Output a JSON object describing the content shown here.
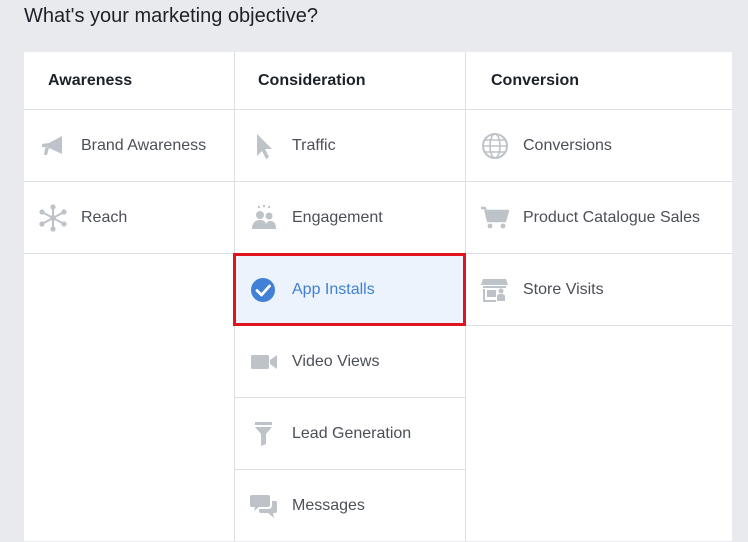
{
  "page_title": "What's your marketing objective?",
  "columns": [
    {
      "header": "Awareness",
      "options": [
        {
          "label": "Brand Awareness",
          "icon": "megaphone-icon"
        },
        {
          "label": "Reach",
          "icon": "reach-icon"
        }
      ]
    },
    {
      "header": "Consideration",
      "options": [
        {
          "label": "Traffic",
          "icon": "cursor-icon"
        },
        {
          "label": "Engagement",
          "icon": "people-icon"
        },
        {
          "label": "App Installs",
          "icon": "checkmark-circle-icon",
          "selected": true
        },
        {
          "label": "Video Views",
          "icon": "video-camera-icon"
        },
        {
          "label": "Lead Generation",
          "icon": "funnel-icon"
        },
        {
          "label": "Messages",
          "icon": "chat-bubbles-icon"
        }
      ]
    },
    {
      "header": "Conversion",
      "options": [
        {
          "label": "Conversions",
          "icon": "globe-icon"
        },
        {
          "label": "Product Catalogue Sales",
          "icon": "shopping-cart-icon"
        },
        {
          "label": "Store Visits",
          "icon": "store-icon"
        }
      ]
    }
  ],
  "colors": {
    "icon_gray": "#bec3c9",
    "selected_blue": "#4080d6",
    "selected_background": "#ecf3fc",
    "highlight_red": "#e0141e"
  }
}
